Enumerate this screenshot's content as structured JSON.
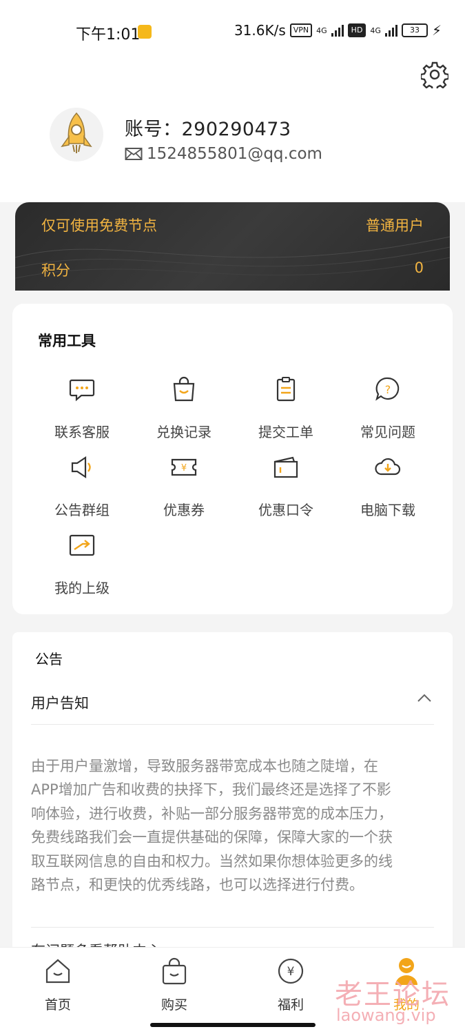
{
  "status_bar": {
    "time": "下午1:01",
    "speed": "31.6K/s",
    "vpn_badge": "VPN",
    "net1": "4G",
    "hd_badge": "HD",
    "net2": "4G",
    "battery": "33"
  },
  "profile": {
    "account_text": "账号：290290473",
    "email": "1524855801@qq.com"
  },
  "vip": {
    "restriction": "仅可使用免费节点",
    "level": "普通用户",
    "points_label": "积分",
    "points_value": "0"
  },
  "tools": {
    "title": "常用工具",
    "items": [
      {
        "label": "联系客服",
        "icon": "chat-icon"
      },
      {
        "label": "兑换记录",
        "icon": "shopping-bag-icon"
      },
      {
        "label": "提交工单",
        "icon": "clipboard-icon"
      },
      {
        "label": "常见问题",
        "icon": "question-icon"
      },
      {
        "label": "公告群组",
        "icon": "megaphone-icon"
      },
      {
        "label": "优惠券",
        "icon": "coupon-icon"
      },
      {
        "label": "优惠口令",
        "icon": "ticket-icon"
      },
      {
        "label": "电脑下载",
        "icon": "cloud-download-icon"
      },
      {
        "label": "我的上级",
        "icon": "trend-up-icon"
      }
    ]
  },
  "notice": {
    "title": "公告",
    "item_title": "用户告知",
    "lines": [
      "由于用户量激增，导致服务器带宽成本也随之陡增，在",
      "APP增加广告和收费的抉择下，我们最终还是选择了不影",
      "响体验，进行收费，补贴一部分服务器带宽的成本压力，",
      "免费线路我们会一直提供基础的保障，保障大家的一个获",
      "取互联网信息的自由和权力。当然如果你想体验更多的线",
      "路节点，和更快的优秀线路，也可以选择进行付费。"
    ],
    "next_item": "有问题多看帮助中心"
  },
  "tabbar": {
    "items": [
      {
        "label": "首页",
        "icon": "home-icon"
      },
      {
        "label": "购买",
        "icon": "bag-icon"
      },
      {
        "label": "福利",
        "icon": "yen-icon"
      },
      {
        "label": "我的",
        "icon": "user-icon"
      }
    ]
  },
  "watermark": {
    "cn": "老王论坛",
    "url": "laowang.vip"
  },
  "colors": {
    "accent": "#f2a51a",
    "gold_text": "#f2b441",
    "card_dark": "#2b2b2b"
  }
}
